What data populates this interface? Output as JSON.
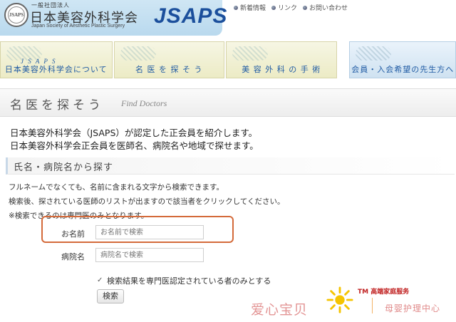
{
  "header": {
    "org_small": "一般社団法人",
    "org_name": "日本美容外科学会",
    "org_english": "Japan Society of Aesthetic Plastic Surgery",
    "logo_text": "JSAPS",
    "seal_text": "JSAPS",
    "links": [
      {
        "label": "新着情報",
        "icon": "bullet-icon"
      },
      {
        "label": "リンク",
        "icon": "bullet-icon"
      },
      {
        "label": "お問い合わせ",
        "icon": "bullet-icon"
      }
    ]
  },
  "nav": {
    "items": [
      {
        "label": "日本美容外科学会について",
        "sub": "J S A P S"
      },
      {
        "label": "名 医 を 探 そ う",
        "sub": ""
      },
      {
        "label": "美 容 外 科 の 手 術",
        "sub": ""
      },
      {
        "label": "会員・入会希望の先生方へ",
        "sub": ""
      }
    ]
  },
  "page": {
    "title_jp": "名医を探そう",
    "title_en": "Find Doctors",
    "intro_line1": "日本美容外科学会（JSAPS）が認定した正会員を紹介します。",
    "intro_line2": "日本美容外科学会正会員を医師名、病院名や地域で探せます。"
  },
  "section": {
    "heading": "氏名・病院名から探す",
    "note1": "フルネームでなくても、名前に含まれる文字から検索できます。",
    "note2": "検索後、探されている医師のリストが出ますので該当者をクリックしてください。",
    "note3": "※検索できるのは専門医のみとなります。"
  },
  "form": {
    "name_label": "お名前",
    "name_placeholder": "お名前で検索",
    "name_value": "",
    "hospital_label": "病院名",
    "hospital_placeholder": "病院名で検索",
    "hospital_value": "",
    "checkbox_label": "検索結果を専門医認定されている者のみとする",
    "checkbox_checked": true,
    "search_button": "検索"
  },
  "watermark": {
    "left_text": "爱心宝贝",
    "tm_text": "TM 高端家庭服务",
    "right_text": "母婴护理中心"
  },
  "colors": {
    "brand_blue": "#1b4f9c",
    "nav_text": "#1f5aa3",
    "highlight": "#d46a3a"
  }
}
